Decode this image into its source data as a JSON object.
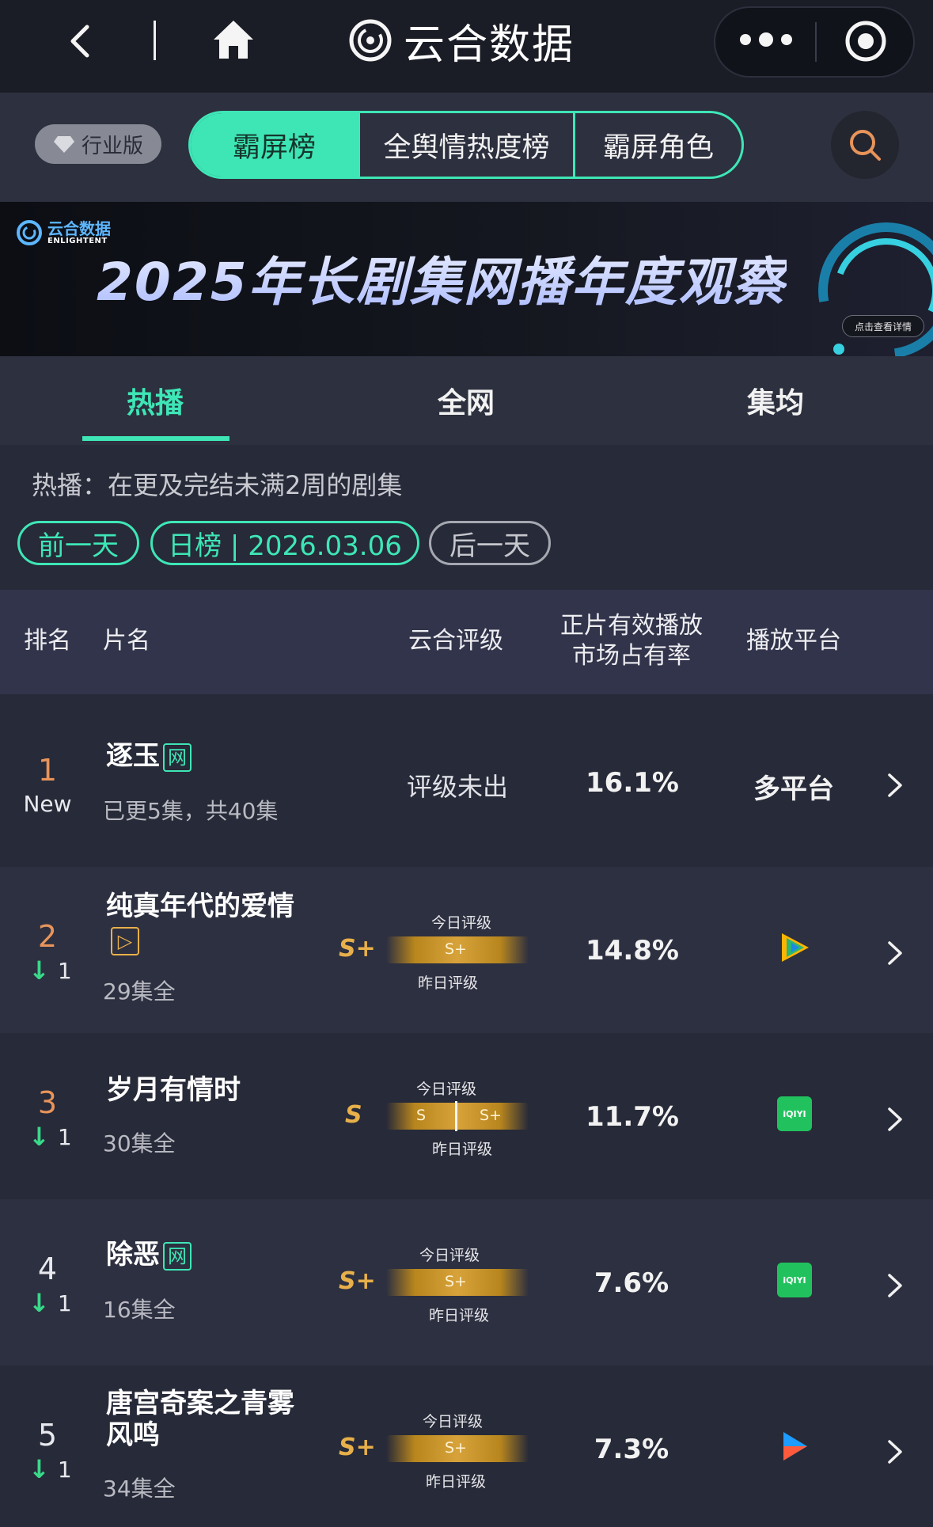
{
  "nav": {
    "brand": "云合数据"
  },
  "subheader": {
    "industry_label": "行业版",
    "segments": [
      "霸屏榜",
      "全舆情热度榜",
      "霸屏角色"
    ]
  },
  "banner": {
    "logo_cn": "云合数据",
    "logo_en": "ENLIGHTENT",
    "title": "2025年长剧集网播年度观察",
    "cta": "点击查看详情"
  },
  "tabs": [
    "热播",
    "全网",
    "集均"
  ],
  "info": {
    "description": "热播：在更及完结未满2周的剧集",
    "prev_day": "前一天",
    "date_label": "日榜 | 2026.03.06",
    "next_day": "后一天"
  },
  "table": {
    "headers": {
      "rank": "排名",
      "title": "片名",
      "grade": "云合评级",
      "share_line1": "正片有效播放",
      "share_line2": "市场占有率",
      "platform": "播放平台"
    },
    "gauge_today": "今日评级",
    "gauge_yesterday": "昨日评级",
    "rows": [
      {
        "rank": "1",
        "change": "New",
        "title": "逐玉",
        "tag": "网",
        "episodes": "已更5集，共40集",
        "grade_status": "评级未出",
        "share": "16.1%",
        "platform": "多平台"
      },
      {
        "rank": "2",
        "change": "1",
        "title_line1": "纯真年代的爱情",
        "tag": "▷",
        "episodes": "29集全",
        "grade": "S+",
        "today": "S+",
        "share": "14.8%",
        "platform_icon": "tencent-video-icon"
      },
      {
        "rank": "3",
        "change": "1",
        "title": "岁月有情时",
        "episodes": "30集全",
        "grade": "S",
        "today_left": "S",
        "today_right": "S+",
        "share": "11.7%",
        "platform_icon": "iqiyi-icon",
        "platform_icon_text": "iQIYI"
      },
      {
        "rank": "4",
        "change": "1",
        "title": "除恶",
        "tag": "网",
        "episodes": "16集全",
        "grade": "S+",
        "today": "S+",
        "share": "7.6%",
        "platform_icon": "iqiyi-icon",
        "platform_icon_text": "iQIYI"
      },
      {
        "rank": "5",
        "change": "1",
        "title_line1": "唐宫奇案之青雾",
        "title_line2": "风鸣",
        "episodes": "34集全",
        "grade": "S+",
        "today": "S+",
        "share": "7.3%",
        "platform_icon": "youku-icon"
      }
    ]
  },
  "colors": {
    "accent": "#3ee6b6",
    "top_rank": "#e8945a",
    "grade_gold": "#e8b04a",
    "down_arrow": "#39d98a"
  }
}
